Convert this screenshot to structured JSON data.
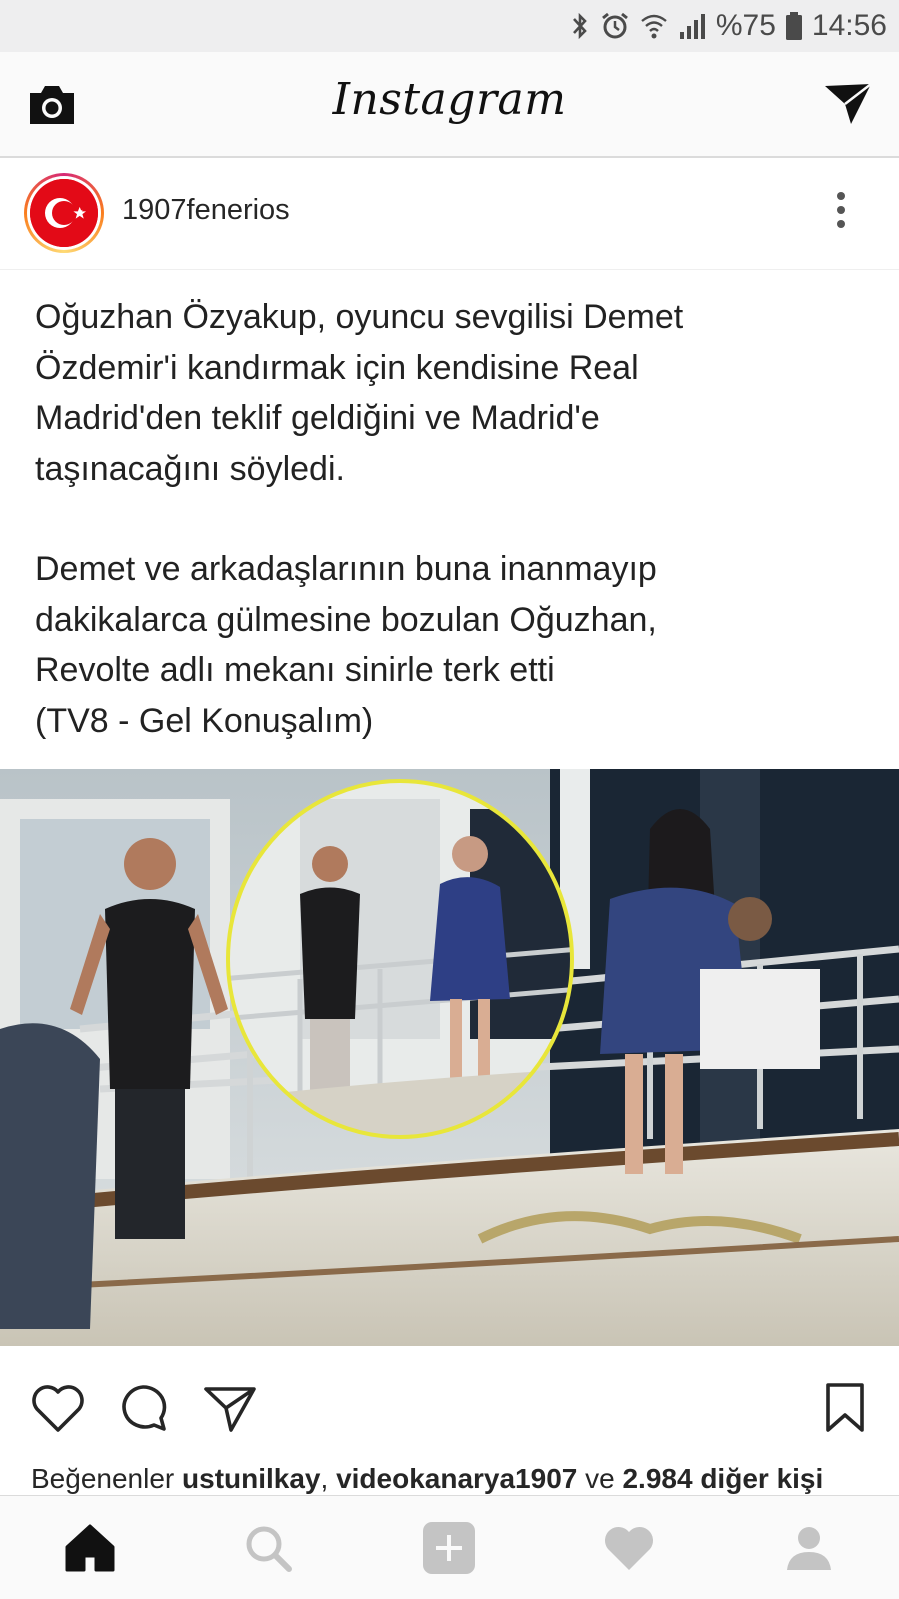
{
  "status_bar": {
    "battery": "%75",
    "time": "14:56"
  },
  "header": {
    "brand": "Instagram",
    "camera_icon": "camera-icon",
    "direct_icon": "paper-plane-icon"
  },
  "post": {
    "username": "1907fenerios",
    "avatar_icon": "turkish-flag-icon",
    "caption_paragraphs": [
      "Oğuzhan Özyakup, oyuncu sevgilisi Demet\nÖzdemir'i kandırmak için kendisine Real\nMadrid'den teklif geldiğini ve Madrid'e\ntaşınacağını söyledi.",
      "Demet ve arkadaşlarının buna inanmayıp\ndakikalarca gülmesine bozulan Oğuzhan,\nRevolte adlı mekanı sinirle terk etti\n(TV8 - Gel Konuşalım)"
    ],
    "likes": {
      "prefix": "Beğenenler ",
      "user1": "ustunilkay",
      "sep": ", ",
      "user2": "videokanarya1907",
      "mid": " ve ",
      "others": "2.984 diğer kişi"
    }
  },
  "actions": [
    "heart-icon",
    "comment-icon",
    "share-icon",
    "bookmark-icon"
  ],
  "bottom_nav": [
    "home-icon",
    "search-icon",
    "add-icon",
    "activity-heart-icon",
    "profile-icon"
  ],
  "colors": {
    "instagram_bg": "#fafafa",
    "text": "#262626",
    "highlight_circle": "#e8e63a",
    "flag_red": "#e30a17"
  }
}
